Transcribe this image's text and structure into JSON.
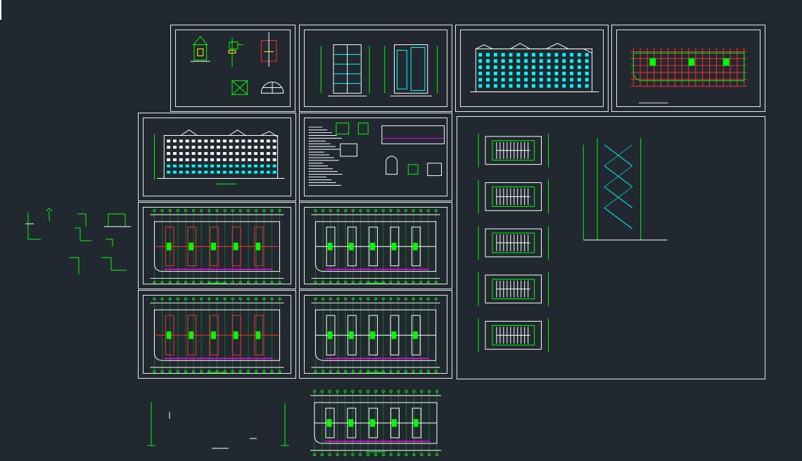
{
  "app": {
    "view": "model-space"
  },
  "colors": {
    "background": "#212830",
    "frame": "#e8e8e8",
    "wall": "#00ff00",
    "window": "#00ffff",
    "axis": "#ff3030",
    "dimension": "#ffffff",
    "furniture": "#ff00ff",
    "highlight": "#ffff00"
  },
  "sheets": [
    {
      "id": "details-top",
      "kind": "details"
    },
    {
      "id": "elevation-side",
      "kind": "side-elevations"
    },
    {
      "id": "elevation-front",
      "kind": "elevation"
    },
    {
      "id": "roof-plan",
      "kind": "floor-plan"
    },
    {
      "id": "elevation-rear",
      "kind": "elevation"
    },
    {
      "id": "notes-details",
      "kind": "notes"
    },
    {
      "id": "stair-sheet",
      "kind": "stairs"
    },
    {
      "id": "plan-ground",
      "kind": "floor-plan"
    },
    {
      "id": "plan-typical-1",
      "kind": "floor-plan"
    },
    {
      "id": "plan-second",
      "kind": "floor-plan"
    },
    {
      "id": "plan-typical-2",
      "kind": "floor-plan"
    },
    {
      "id": "plan-loose",
      "kind": "floor-plan"
    }
  ]
}
